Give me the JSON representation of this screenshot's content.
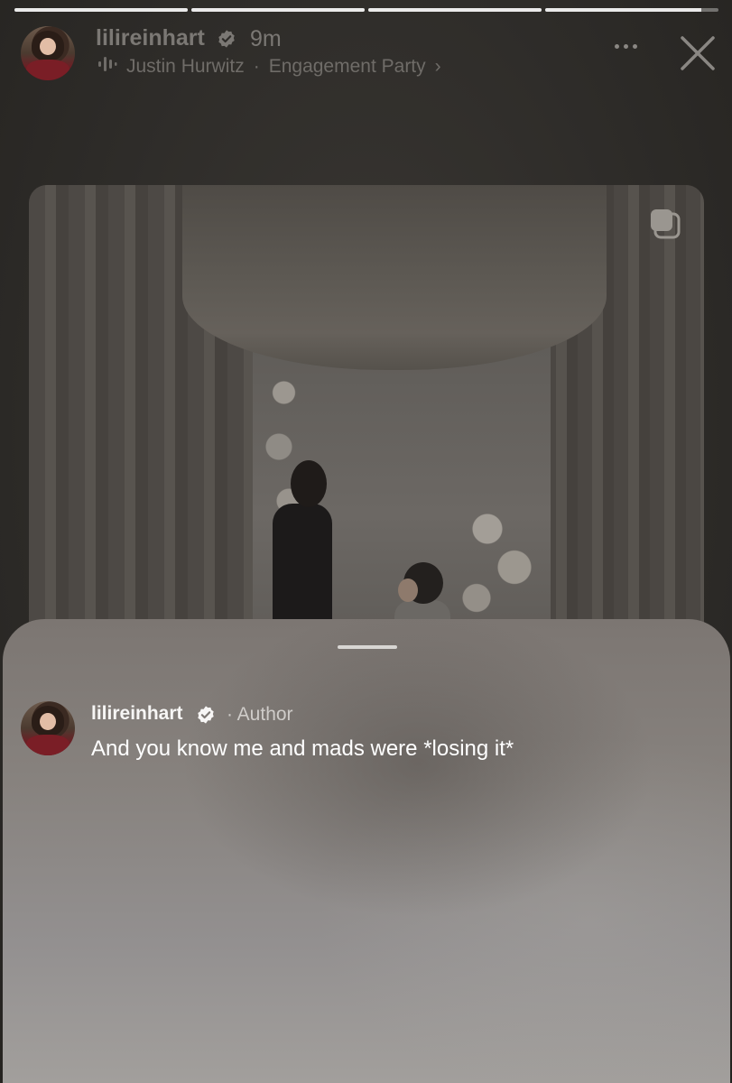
{
  "story": {
    "segments": [
      {
        "progress": 1
      },
      {
        "progress": 1
      },
      {
        "progress": 1
      },
      {
        "progress": 0.9
      }
    ],
    "username": "lilireinhart",
    "time": "9m",
    "music": {
      "artist": "Justin Hurwitz",
      "separator": "·",
      "track": "Engagement Party",
      "chevron": "›"
    },
    "icons": {
      "verified": "verified-badge-icon",
      "audio": "audio-waveform-icon",
      "more": "more-dots-icon",
      "close": "close-icon",
      "carousel": "carousel-stack-icon"
    }
  },
  "comment": {
    "username": "lilireinhart",
    "role": "· Author",
    "text": "And you know me and mads were *losing it*"
  }
}
